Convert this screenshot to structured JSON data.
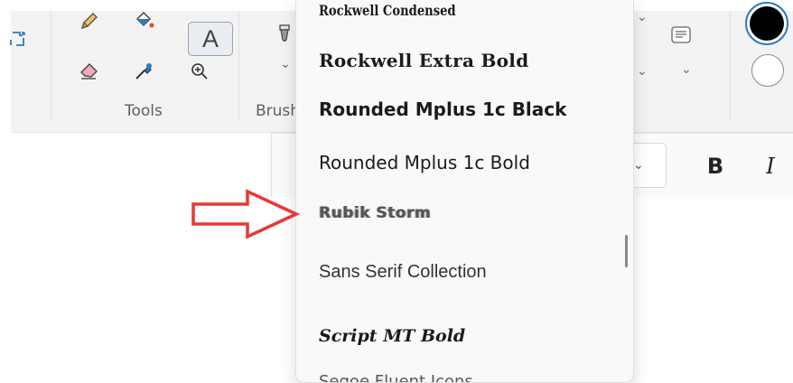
{
  "ribbon": {
    "groups": {
      "tools_label": "Tools",
      "brushes_label": "Brush"
    },
    "text_tool_label": "A",
    "icons": {
      "select": "select-icon",
      "pencil": "pencil-icon",
      "fill": "fill-bucket-icon",
      "text": "text-icon",
      "eraser": "eraser-icon",
      "color_picker": "color-picker-icon",
      "magnifier": "magnifier-icon",
      "brush": "brush-icon",
      "shapes_outline": "shape-outline-icon"
    },
    "colors": {
      "primary": "#000000",
      "secondary": "#ffffff",
      "accent": "#2f7bbf"
    }
  },
  "text_toolbar": {
    "bold_label": "B",
    "italic_label": "I"
  },
  "font_dropdown": {
    "items": [
      {
        "label": "Rockwell Condensed"
      },
      {
        "label": "Rockwell Extra Bold"
      },
      {
        "label": "Rounded Mplus 1c Black"
      },
      {
        "label": "Rounded Mplus 1c Bold"
      },
      {
        "label": "Rubik Storm"
      },
      {
        "label": "Sans Serif Collection"
      },
      {
        "label": "Script MT Bold"
      },
      {
        "label": "Segoe Fluent Icons"
      }
    ],
    "highlighted": "Rubik Storm"
  },
  "annotation": {
    "arrow_color": "#e53935"
  }
}
